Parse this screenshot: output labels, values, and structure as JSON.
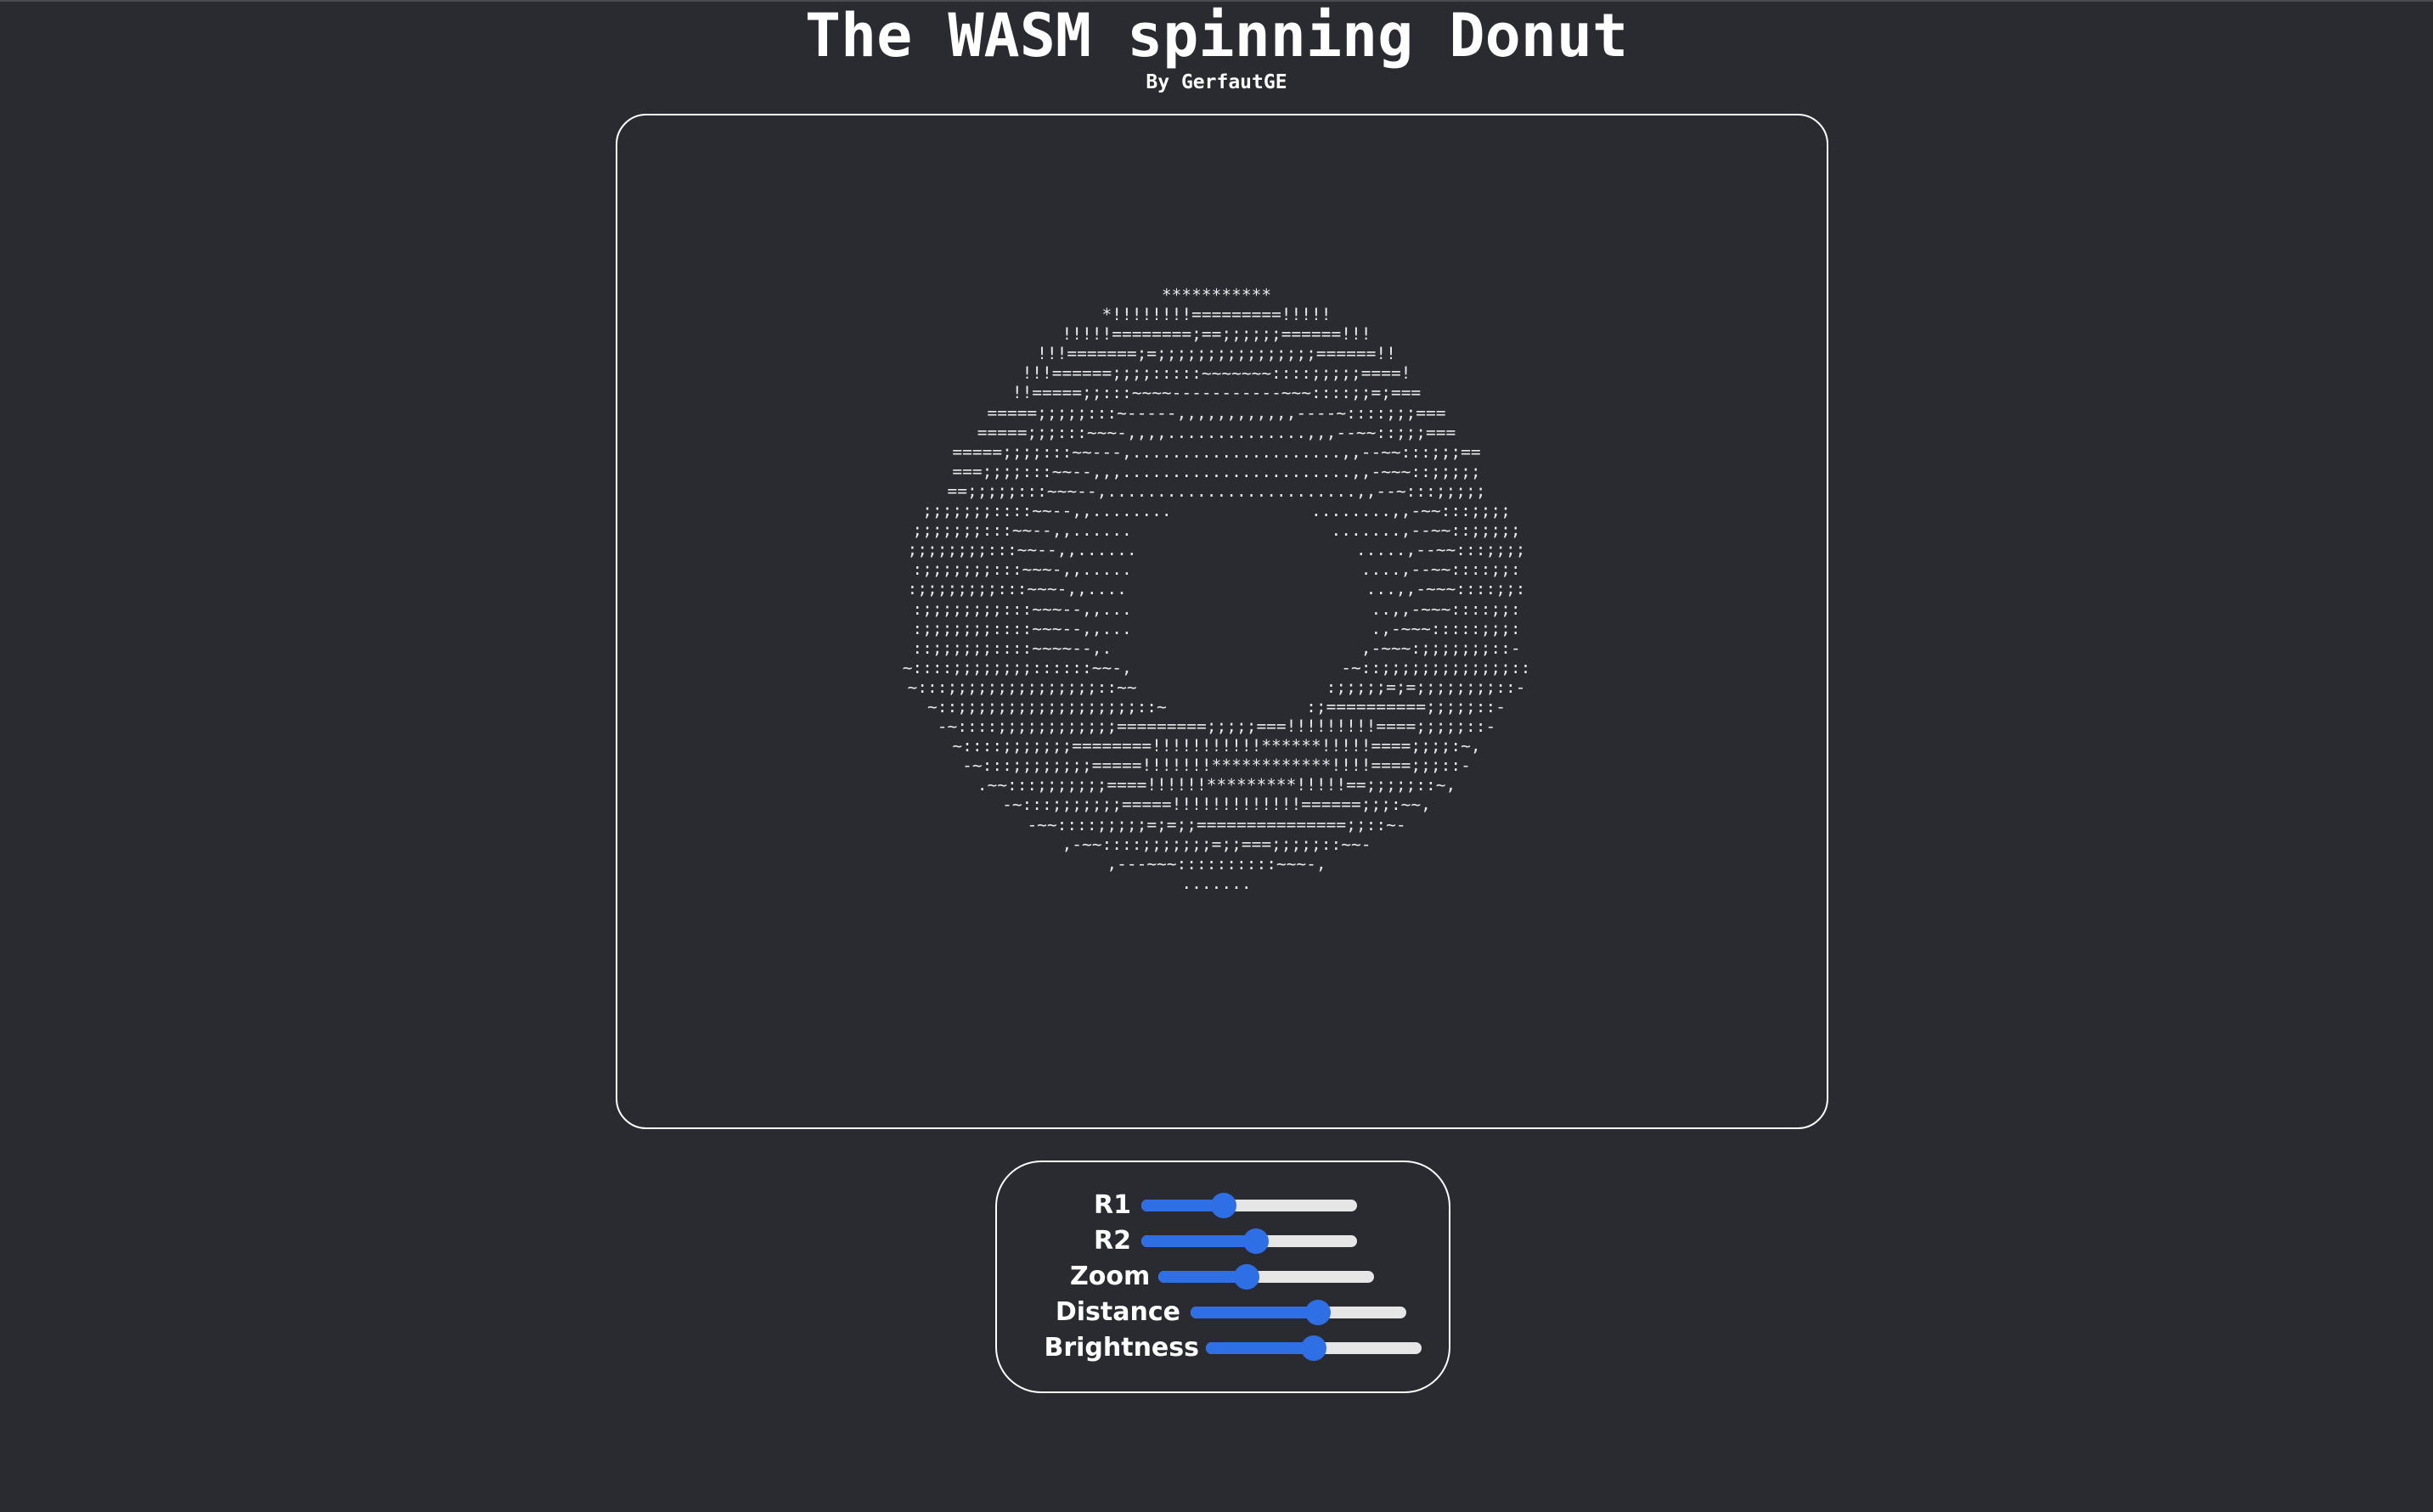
{
  "header": {
    "title": "The WASM spinning Donut",
    "subtitle": "By GerfautGE"
  },
  "donut": {
    "ascii_lines": [
      "***********",
      "*!!!!!!!!=========!!!!!",
      "!!!!!========;==;;;;;;======!!!",
      "!!!=======;=;;;;;;;;;;;;;;;;======!!",
      "!!!======;;;;:::::~~~~~~~::::;;;;;====!",
      "!!=====;;:::~~~~-----------~~~::::;;=;===",
      "=====;;;;;:::~-----,,,,,,,,,,,,----~::::;;;===",
      "=====;;;:::~~~-,,,,..............,,,--~~::;;;===",
      "=====;;;;:::~~---,.....................,,--~~:::;;;==",
      "===;;;;:::~~--,,,.......................,,-~~~::;;;;;",
      "==;;;;;:::~~~--,.........................,,--~:::;;;;;",
      ";;;;;;;::::~~--,,........              ........,,-~~:::;;;;",
      ";;;;;;;:::~~--,,......                    .......,--~~::;;;;;",
      ";;;;;;;;:::~~--,,......                      .....,--~~:::;;;;",
      ":;;;;;;;:::~~~-,,.....                       ....,--~~::::;;:",
      ":;;;;;;;;:::~~~-,,....                        ...,,-~~~::::;;:",
      ":;;;;;;;;:::~~~--,,...                        ..,,-~~~::::;;:",
      ":;;;;;;;::::~~~--,,...                        .,-~~~:::::;;;:",
      "::;;;;;;::::~~~~--,.                         ,-~~~:;;;;;;;::-",
      "~::::;;;;;;;;::::::~~-,                     -~::;;;;;;;;;;;;;::",
      "~:::;;;;;;;;;;;;;;;::~~                   :;;;;;=;=;;;;;;;;::-",
      "~::;;;;;;;;;;;;;;;;;;::~              :;==========;;;;;::-",
      "-~::::;;;;;;;;;;;;=========;;;;;===!!!!!!!!!====;;;;;::-",
      "~::::;;;;;;;========!!!!!!!!!!!******!!!!!====;;;;:~,",
      "-~:::;;;;;;;;=====!!!!!!!************!!!!====;;;::-",
      ".~~:::;;;;;;;====!!!!!!*********!!!!!==;;;;;::~,",
      "-~:::;;;;;;;=====!!!!!!!!!!!!!======;;;:~~,",
      "-~~::::;;;;;=;=;;===============;;::~-",
      ",-~~::::;;;;;;;=;;===;;;;;::~~-",
      ",---~~~::::::::::~~~-,",
      "......."
    ]
  },
  "controls": {
    "sliders": [
      {
        "name": "r1",
        "label": "R1",
        "value": 0.38
      },
      {
        "name": "r2",
        "label": "R2",
        "value": 0.53
      },
      {
        "name": "zoom",
        "label": "Zoom",
        "value": 0.41
      },
      {
        "name": "distance",
        "label": "Distance",
        "value": 0.59
      },
      {
        "name": "brightness",
        "label": "Brightness",
        "value": 0.5
      }
    ]
  },
  "colors": {
    "background": "#2a2b30",
    "accent": "#2f6fe6",
    "track": "#e6e6e6",
    "text": "#ffffff"
  }
}
